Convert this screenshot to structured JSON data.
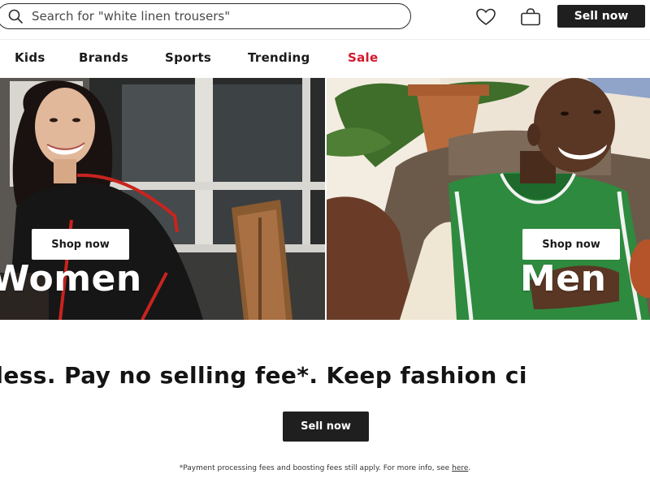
{
  "header": {
    "search": {
      "placeholder": "Search for \"white linen trousers\"",
      "value": "",
      "icon": "search-icon"
    },
    "icons": [
      "heart-icon",
      "shopping-bag-icon"
    ],
    "sell_button": "Sell now"
  },
  "nav": {
    "items": [
      {
        "label": "Kids"
      },
      {
        "label": "Brands"
      },
      {
        "label": "Sports"
      },
      {
        "label": "Trending"
      },
      {
        "label": "Sale",
        "color": "#d6172b"
      }
    ]
  },
  "hero": {
    "women": {
      "title": "Women",
      "button": "Shop now"
    },
    "men": {
      "title": "Men",
      "button": "Shop now"
    }
  },
  "promo": {
    "headline": "r less. Pay no selling fee*. Keep fashion ci",
    "button": "Sell now",
    "footnote_text": "*Payment processing fees and boosting fees still apply. For more info, see ",
    "footnote_link": "here",
    "footnote_end": "."
  },
  "colors": {
    "accent_sale": "#d6172b",
    "button_dark": "#1f1f1f",
    "background": "#ffffff"
  }
}
